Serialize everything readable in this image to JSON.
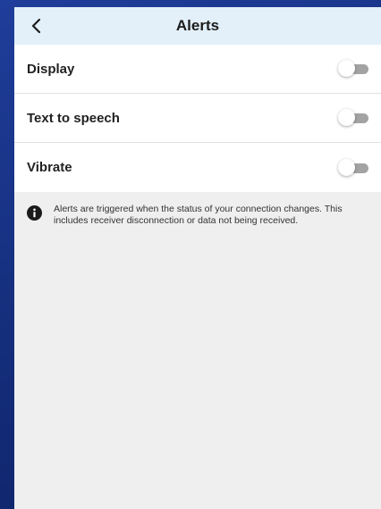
{
  "colors": {
    "header_bg": "#e3f0fa",
    "content_bg": "#efefef",
    "toggle_off_track": "#a3a3a3",
    "background_blue": "#16307f"
  },
  "header": {
    "back_icon": "chevron-left-icon",
    "title": "Alerts"
  },
  "settings": [
    {
      "label": "Display",
      "enabled": false
    },
    {
      "label": "Text to speech",
      "enabled": false
    },
    {
      "label": "Vibrate",
      "enabled": false
    }
  ],
  "info": {
    "icon": "info-icon",
    "text": "Alerts are triggered when the status of your connection changes. This includes receiver disconnection or data not being received."
  }
}
